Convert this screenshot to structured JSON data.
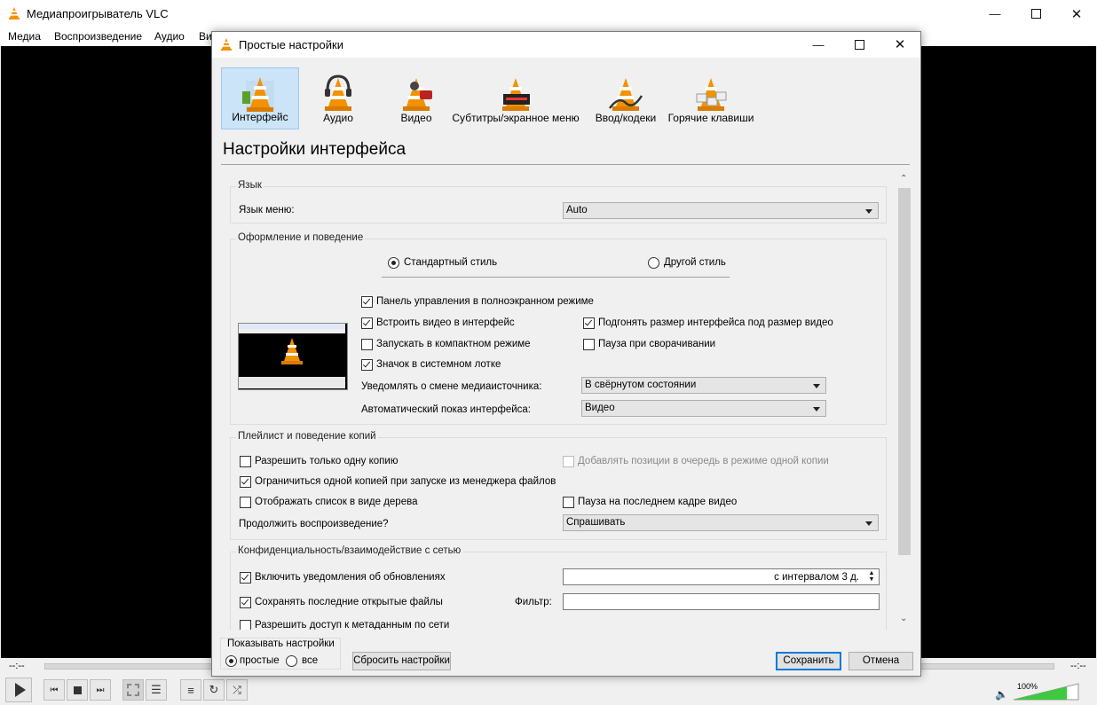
{
  "main_window": {
    "title": "Медиапроигрыватель VLC",
    "menu": [
      "Медиа",
      "Воспроизведение",
      "Аудио",
      "Ви"
    ],
    "time_left": "--:--",
    "time_right": "--:--",
    "volume": "100%"
  },
  "dialog": {
    "title": "Простые настройки",
    "categories": [
      {
        "label": "Интерфейс",
        "icon": "interface-cone-icon",
        "selected": true
      },
      {
        "label": "Аудио",
        "icon": "audio-cone-icon"
      },
      {
        "label": "Видео",
        "icon": "video-cone-icon"
      },
      {
        "label": "Субтитры/экранное меню",
        "icon": "subtitles-cone-icon"
      },
      {
        "label": "Ввод/кодеки",
        "icon": "codecs-cone-icon"
      },
      {
        "label": "Горячие клавиши",
        "icon": "hotkeys-cone-icon"
      }
    ],
    "heading": "Настройки интерфейса",
    "language": {
      "group_title": "Язык",
      "menu_lang_label": "Язык меню:",
      "menu_lang_value": "Auto"
    },
    "look": {
      "group_title": "Оформление и поведение",
      "style_native": "Стандартный стиль",
      "style_other": "Другой стиль",
      "fullscreen_controls": "Панель управления в полноэкранном режиме",
      "embed_video": "Встроить видео в интерфейс",
      "resize_interface": "Подгонять размер интерфейса под размер видео",
      "compact_mode": "Запускать в компактном режиме",
      "pause_minimized": "Пауза при сворачивании",
      "systray_icon": "Значок в системном лотке",
      "notify_label": "Уведомлять о смене медиаисточника:",
      "notify_value": "В свёрнутом состоянии",
      "autoraise_label": "Автоматический показ интерфейса:",
      "autoraise_value": "Видео"
    },
    "playlist": {
      "group_title": "Плейлист и поведение копий",
      "one_instance": "Разрешить только одну копию",
      "enqueue_one": "Добавлять позиции в очередь в режиме одной копии",
      "one_instance_fm": "Ограничиться одной копией при запуске из менеджера файлов",
      "tree_view": "Отображать список в виде дерева",
      "pause_last_frame": "Пауза на последнем кадре видео",
      "resume_label": "Продолжить воспроизведение?",
      "resume_value": "Спрашивать"
    },
    "privacy": {
      "group_title": "Конфиденциальность/взаимодействие с сетью",
      "update_notify": "Включить уведомления об обновлениях",
      "update_interval": "с интервалом 3 д.",
      "save_recent": "Сохранять последние открытые файлы",
      "filter_label": "Фильтр:",
      "filter_value": "",
      "metadata_network": "Разрешить доступ к метаданным по сети"
    },
    "show_settings": {
      "title": "Показывать настройки",
      "simple": "простые",
      "all": "все"
    },
    "reset_button": "Сбросить настройки",
    "save_button": "Сохранить",
    "cancel_button": "Отмена"
  },
  "colors": {
    "cone_orange": "#f29200",
    "selected_category": "#cce4f7",
    "default_button_border": "#0078d7"
  }
}
